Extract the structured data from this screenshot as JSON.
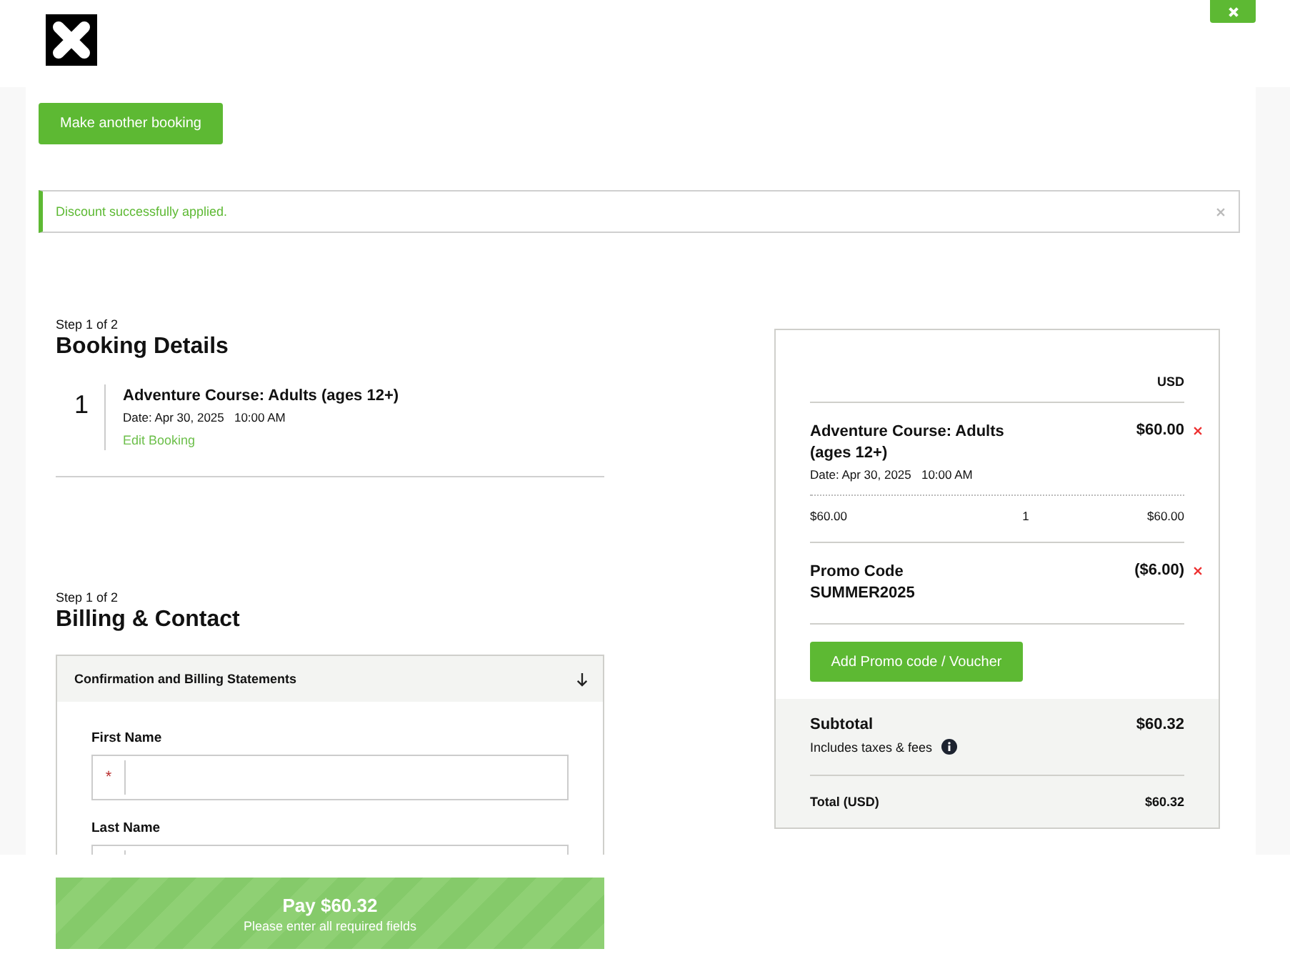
{
  "header": {
    "close_button": {
      "kind": "close"
    }
  },
  "new_booking_button": "Make another booking",
  "alert": {
    "kind": "success",
    "message": "Discount successfully applied."
  },
  "booking_details": {
    "step": "Step 1 of 2",
    "title": "Booking Details",
    "items": [
      {
        "number": "1",
        "title": "Adventure Course: Adults (ages 12+)",
        "date": "Date: Apr 30, 2025   10:00 AM",
        "edit_link": "Edit Booking"
      }
    ]
  },
  "billing": {
    "step": "Step 1 of 2",
    "title": "Billing & Contact",
    "accordion": {
      "title": "Confirmation and Billing Statements",
      "expanded": true,
      "fields": [
        {
          "label": "First Name",
          "required_mark": "*"
        },
        {
          "label": "Last Name"
        }
      ]
    }
  },
  "summary": {
    "currency": "USD",
    "items": [
      {
        "kind": "booking",
        "title": "Adventure Course: Adults (ages 12+)",
        "date": "Date: Apr 30, 2025   10:00 AM",
        "price": "$60.00",
        "unit_price": "$60.00",
        "quantity": "1",
        "line_total": "$60.00"
      },
      {
        "kind": "promo",
        "title": "Promo Code",
        "code": "SUMMER2025",
        "price": "($6.00)"
      }
    ],
    "promo_button": "Add Promo code / Voucher",
    "subtotal_label": "Subtotal",
    "subtotal": "$60.32",
    "fees_note": "Includes taxes & fees",
    "total_label": "Total (USD)",
    "total": "$60.32"
  },
  "pay_button": {
    "label": "Pay $60.32",
    "hint": "Please enter all required fields",
    "disabled": true
  }
}
